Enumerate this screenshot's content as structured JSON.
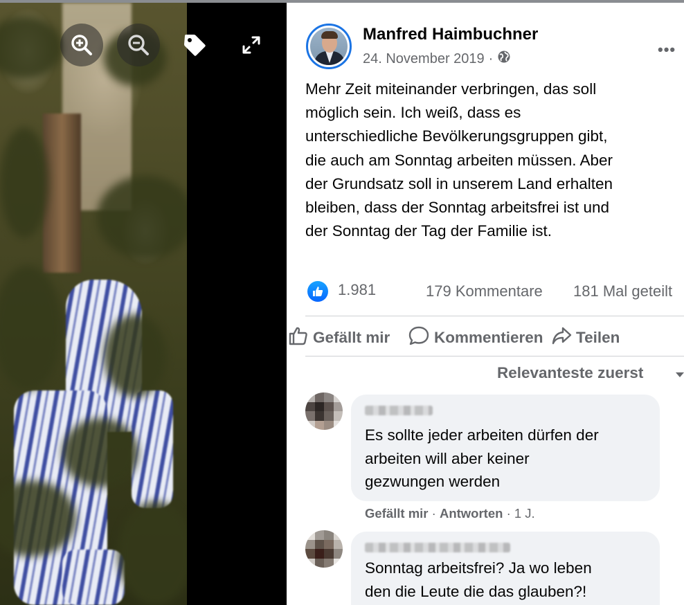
{
  "viewer": {
    "zoom_in_icon": "zoom-in-icon",
    "zoom_out_icon": "zoom-out-icon",
    "tag_icon": "tag-icon",
    "fullscreen_icon": "expand-icon"
  },
  "post": {
    "author": "Manfred Haimbuchner",
    "date": "24. November 2019",
    "separator": "·",
    "audience_icon": "globe-icon",
    "more_label": "•••",
    "text_lines": [
      "Mehr Zeit miteinander verbringen, das soll",
      "möglich sein. Ich weiß, dass es",
      "unterschiedliche Bevölkerungsgruppen gibt,",
      "die auch am Sonntag arbeiten müssen. Aber",
      "der Grundsatz soll in unserem Land erhalten",
      "bleiben, dass der Sonntag arbeitsfrei ist und",
      "der Sonntag der Tag der Familie ist."
    ]
  },
  "stats": {
    "likes": "1.981",
    "comments": "179 Kommentare",
    "shares": "181 Mal geteilt"
  },
  "actions": {
    "like": "Gefällt mir",
    "comment": "Kommentieren",
    "share": "Teilen"
  },
  "comments_section": {
    "sort_label": "Relevanteste zuerst",
    "comments": [
      {
        "text_lines": [
          "Es sollte jeder arbeiten dürfen der",
          "arbeiten will aber keiner",
          "gezwungen werden"
        ],
        "like_label": "Gefällt mir",
        "reply_label": "Antworten",
        "age": "1 J."
      },
      {
        "text_lines": [
          "Sonntag arbeitsfrei? Ja wo leben",
          "den die Leute die das glauben?!"
        ]
      }
    ]
  },
  "colors": {
    "accent": "#1b74e4",
    "secondary_text": "#65676b",
    "bubble": "#f0f2f5"
  }
}
